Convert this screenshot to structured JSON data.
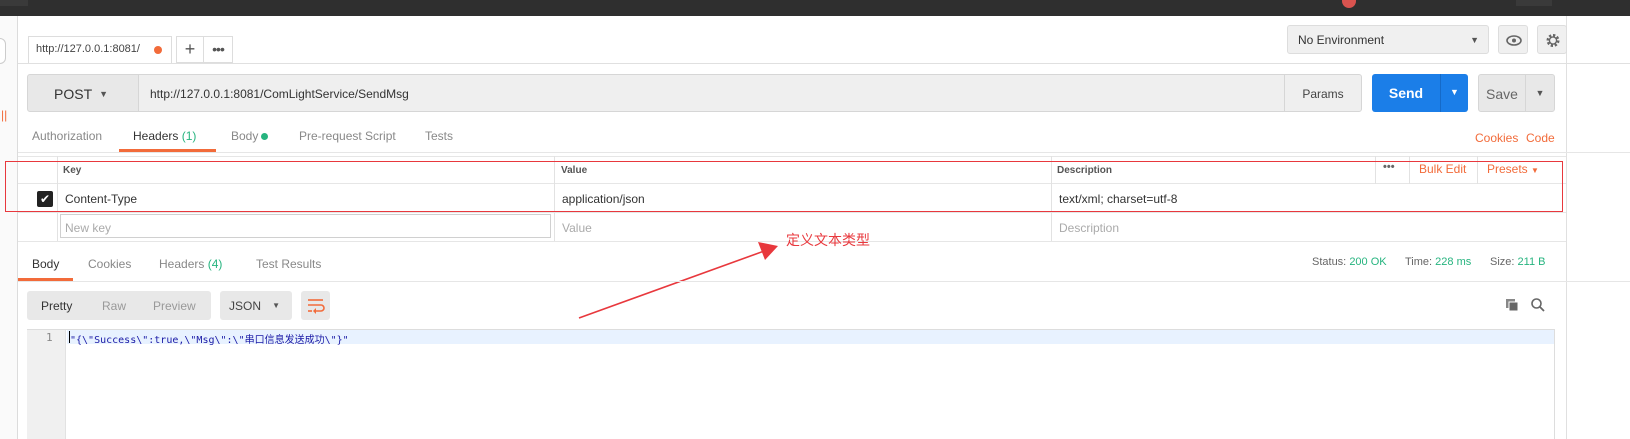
{
  "tab": {
    "title": "http://127.0.0.1:8081/"
  },
  "environment": {
    "selected": "No Environment"
  },
  "request": {
    "method": "POST",
    "url": "http://127.0.0.1:8081/ComLightService/SendMsg",
    "params_label": "Params",
    "send_label": "Send",
    "save_label": "Save"
  },
  "request_tabs": {
    "authorization": "Authorization",
    "headers": "Headers",
    "headers_count": "(1)",
    "body": "Body",
    "prerequest": "Pre-request Script",
    "tests": "Tests",
    "cookies": "Cookies",
    "code": "Code"
  },
  "headers_table": {
    "col_key": "Key",
    "col_value": "Value",
    "col_description": "Description",
    "more": "•••",
    "bulk_edit": "Bulk Edit",
    "presets": "Presets",
    "rows": [
      {
        "key": "Content-Type",
        "value": "application/json",
        "description": "text/xml; charset=utf-8"
      }
    ],
    "placeholder_key": "New key",
    "placeholder_value": "Value",
    "placeholder_description": "Description"
  },
  "annotation": {
    "text": "定义文本类型",
    "color": "#e8383d"
  },
  "response_tabs": {
    "body": "Body",
    "cookies": "Cookies",
    "headers": "Headers",
    "headers_count": "(4)",
    "test_results": "Test Results"
  },
  "response_status": {
    "status_label": "Status:",
    "status_value": "200 OK",
    "time_label": "Time:",
    "time_value": "228 ms",
    "size_label": "Size:",
    "size_value": "211 B"
  },
  "response_format": {
    "pretty": "Pretty",
    "raw": "Raw",
    "preview": "Preview",
    "language": "JSON"
  },
  "response_body": {
    "line_number": "1",
    "text": "\"{\\\"Success\\\":true,\\\"Msg\\\":\\\"串口信息发送成功\\\"}\""
  },
  "icons": [
    "plus-icon",
    "more-icon",
    "eye-icon",
    "gear-icon",
    "caret-down-icon",
    "checkbox-checked-icon",
    "wrap-icon",
    "copy-icon",
    "search-icon",
    "arrow-annotation"
  ],
  "colors": {
    "accent": "#f26b3a",
    "send": "#1b7ee8",
    "success": "#26b47f",
    "annotation": "#e8383d"
  }
}
